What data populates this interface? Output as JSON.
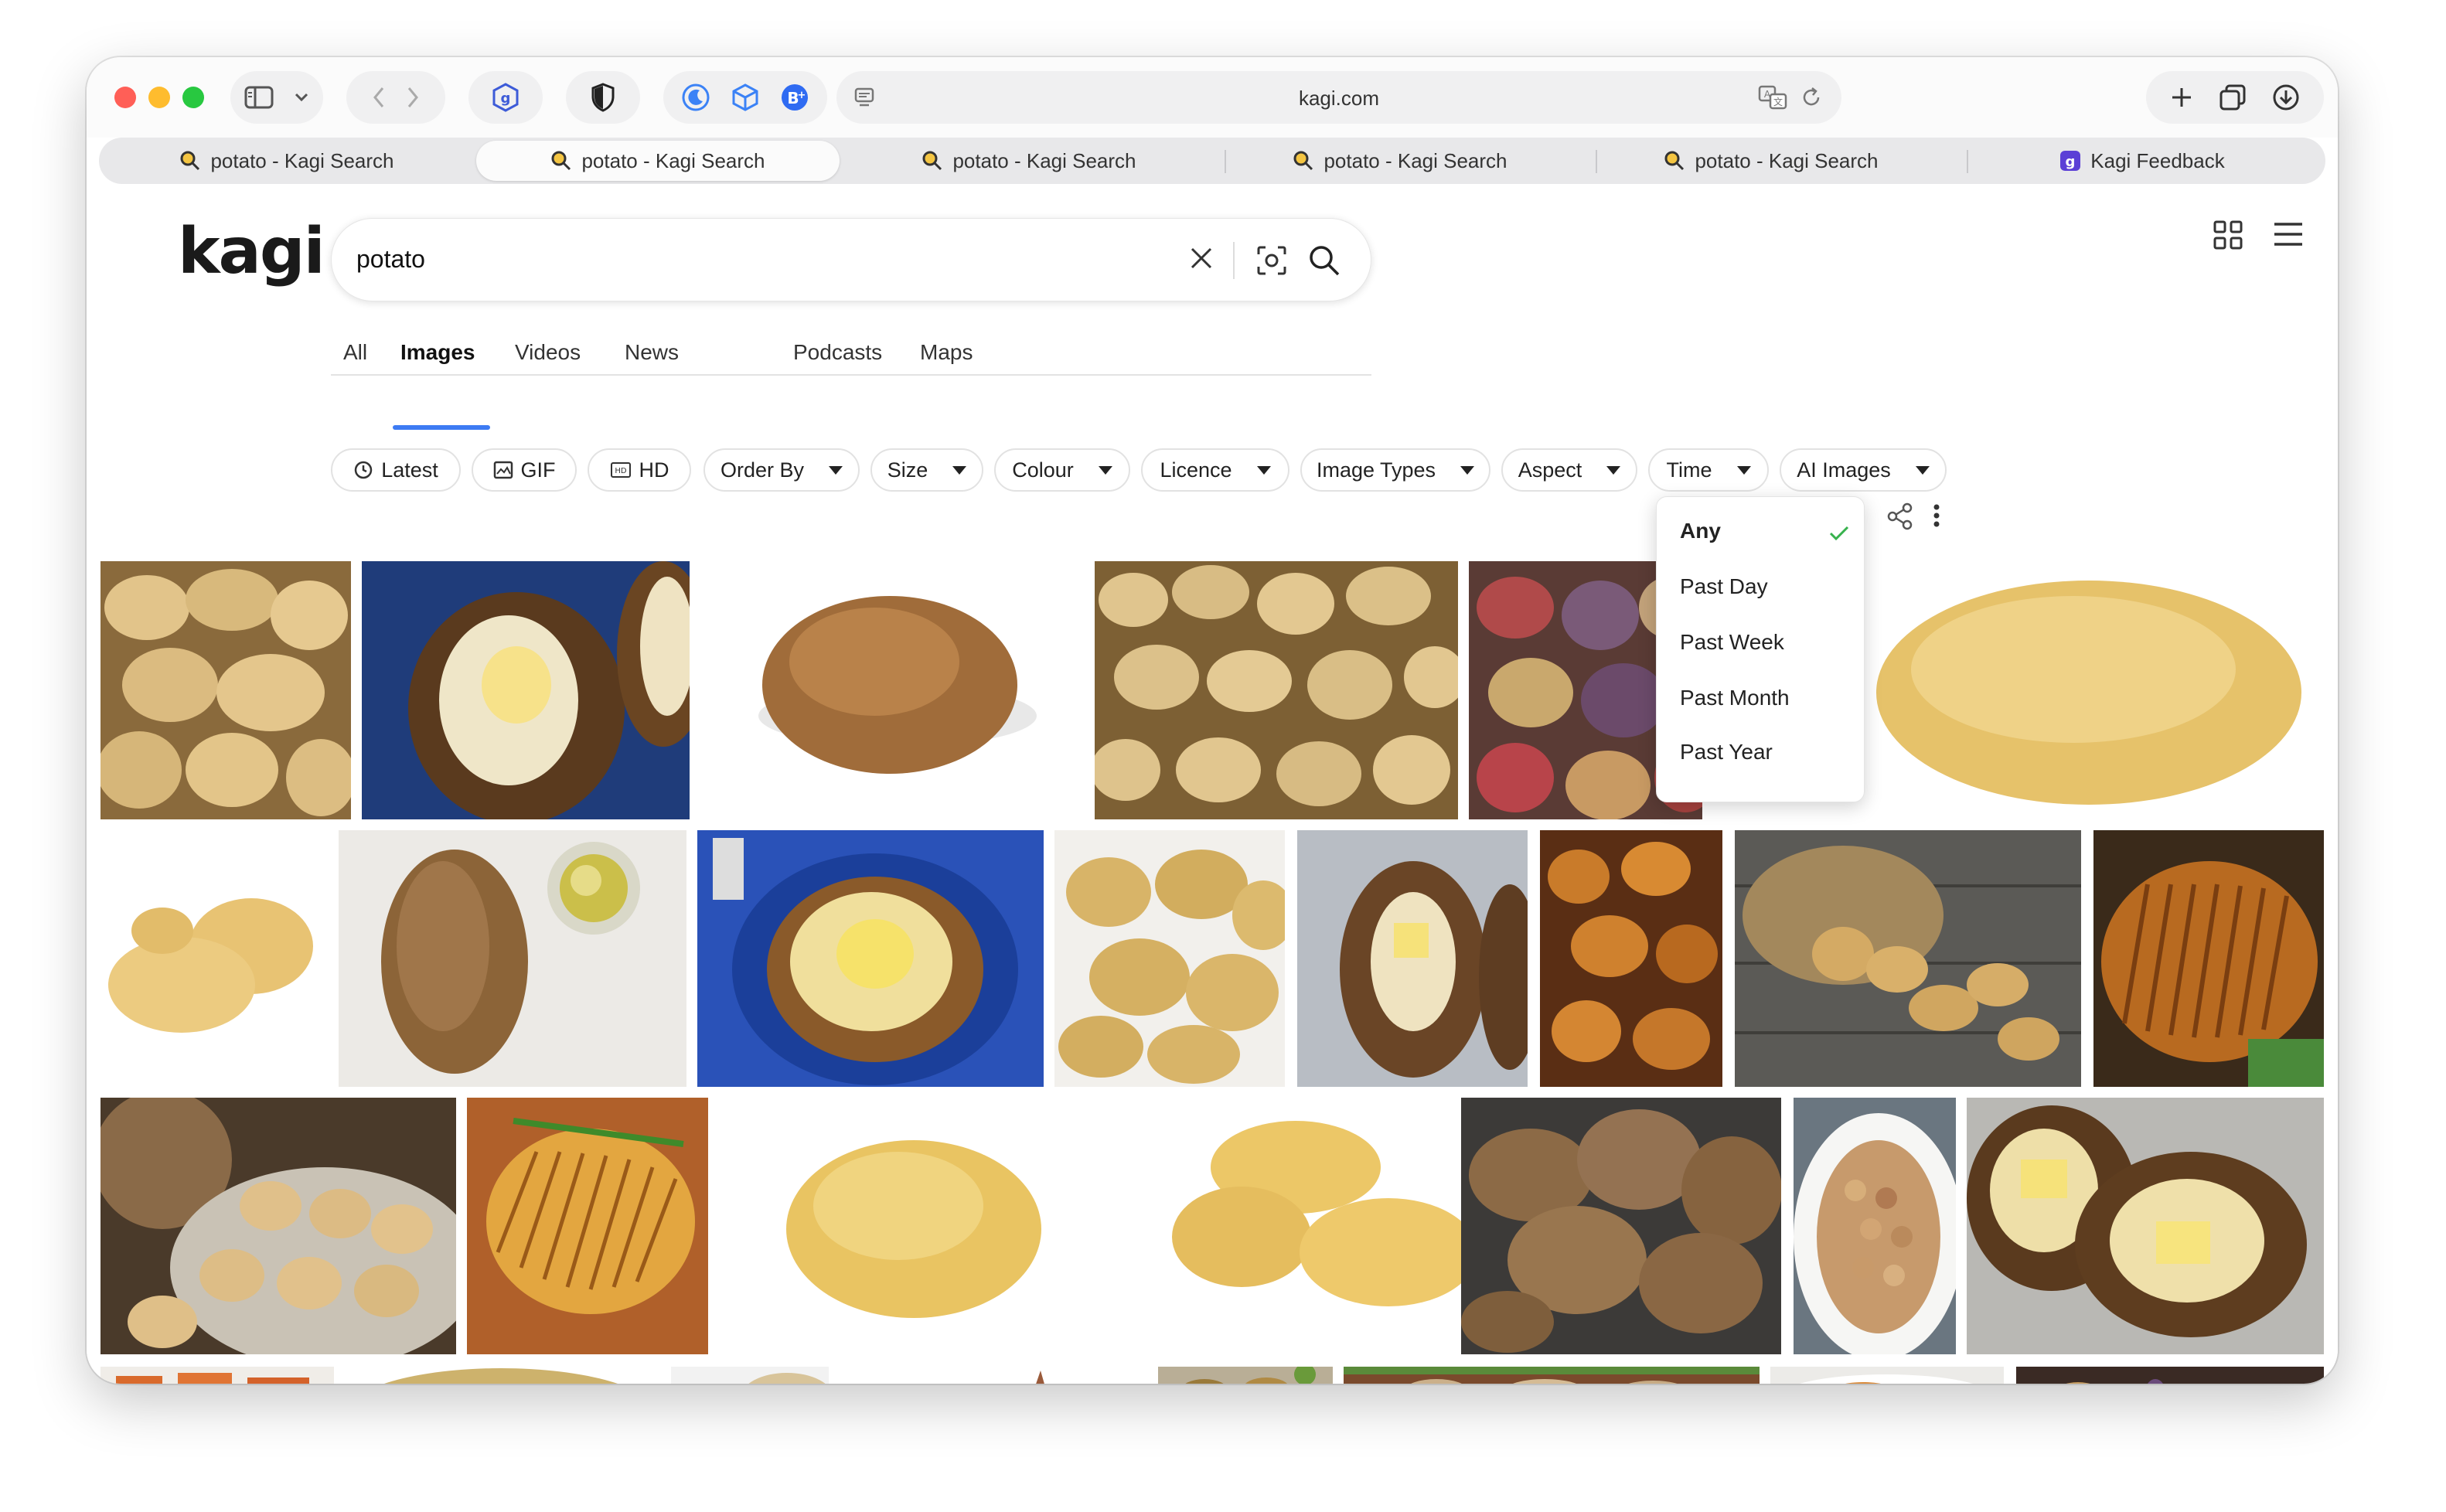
{
  "browser": {
    "url": "kagi.com",
    "tabs": [
      {
        "label": "potato - Kagi Search",
        "active": false
      },
      {
        "label": "potato - Kagi Search",
        "active": true
      },
      {
        "label": "potato - Kagi Search",
        "active": false
      },
      {
        "label": "potato - Kagi Search",
        "active": false
      },
      {
        "label": "potato - Kagi Search",
        "active": false
      },
      {
        "label": "Kagi Feedback",
        "active": false
      }
    ]
  },
  "page": {
    "logo": "kagi",
    "search": {
      "query": "potato"
    },
    "nav_tabs": [
      {
        "label": "All"
      },
      {
        "label": "Images",
        "active": true
      },
      {
        "label": "Videos"
      },
      {
        "label": "News"
      },
      {
        "label": "Podcasts"
      },
      {
        "label": "Maps"
      }
    ],
    "filters": {
      "latest": "Latest",
      "gif": "GIF",
      "hd": "HD",
      "order_by": "Order By",
      "size": "Size",
      "colour": "Colour",
      "licence": "Licence",
      "image_types": "Image Types",
      "aspect": "Aspect",
      "time": "Time",
      "ai_images": "AI Images"
    },
    "time_dropdown": {
      "options": [
        "Any",
        "Past Day",
        "Past Week",
        "Past Month",
        "Past Year"
      ],
      "selected": "Any"
    },
    "results": [
      "potato pile",
      "baked potato on blue plate",
      "single russet potato",
      "potatoes pile",
      "red and purple potatoes",
      "yellow potato",
      "yellow potatoes",
      "russet potato with oil",
      "baked potato with chives",
      "boiled potatoes",
      "baked potato with butter",
      "roasted potatoes",
      "potatoes in burlap sack",
      "hasselback potato",
      "potatoes in bowl",
      "hasselback potato on board",
      "single yellow potato",
      "yellow potatoes",
      "russet potatoes",
      "baby potatoes in bowl",
      "baked potatoes with butter",
      "sweet potato fries",
      "potato",
      "potato",
      "sweet potato",
      "roasted potatoes tray",
      "potatoes in soil",
      "potato dish",
      "assorted potatoes"
    ]
  },
  "colors": {
    "accent": "#3d7bf3",
    "check": "#37b24d",
    "traffic_red": "#ff5f57",
    "traffic_yellow": "#febc2e",
    "traffic_green": "#28c840"
  }
}
